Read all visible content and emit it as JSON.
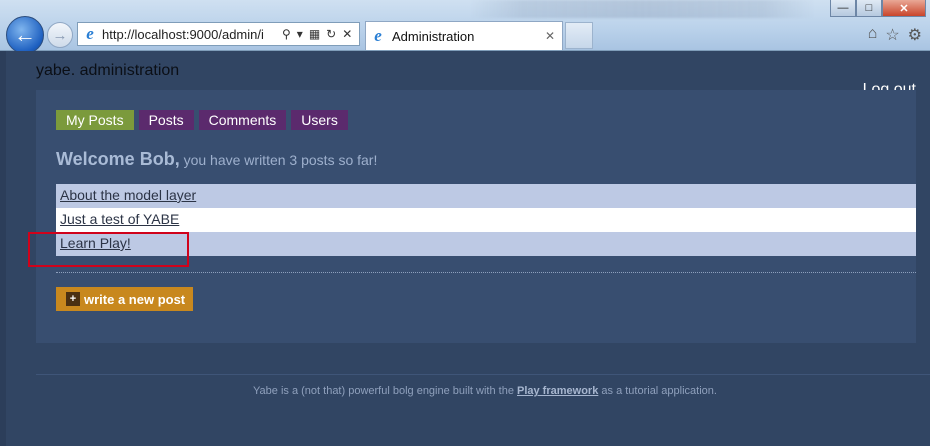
{
  "browser": {
    "url": "http://localhost:9000/admin/i",
    "tab_title": "Administration",
    "back_icon": "back-arrow-icon",
    "forward_icon": "forward-arrow-icon"
  },
  "header": {
    "site_title": "yabe. administration",
    "logout_label": "Log out"
  },
  "nav_tabs": [
    {
      "label": "My Posts",
      "active": true
    },
    {
      "label": "Posts",
      "active": false
    },
    {
      "label": "Comments",
      "active": false
    },
    {
      "label": "Users",
      "active": false
    }
  ],
  "welcome": {
    "strong": "Welcome Bob,",
    "rest": "you have written 3 posts so far!"
  },
  "posts": [
    "About the model layer",
    "Just a test of YABE",
    "Learn Play!"
  ],
  "actions": {
    "new_post_label": "write a new post"
  },
  "footer": {
    "prefix": "Yabe is a (not that) powerful bolg engine built with the",
    "link": "Play framework",
    "suffix": "as a tutorial application."
  },
  "colors": {
    "page_bg": "#314563",
    "panel_bg": "#384e70",
    "active_tab": "#7b9a3c",
    "tab": "#5b2a6d",
    "row_odd": "#bdc9e4",
    "new_post_button": "#c8881e",
    "highlight": "#d0021b"
  }
}
